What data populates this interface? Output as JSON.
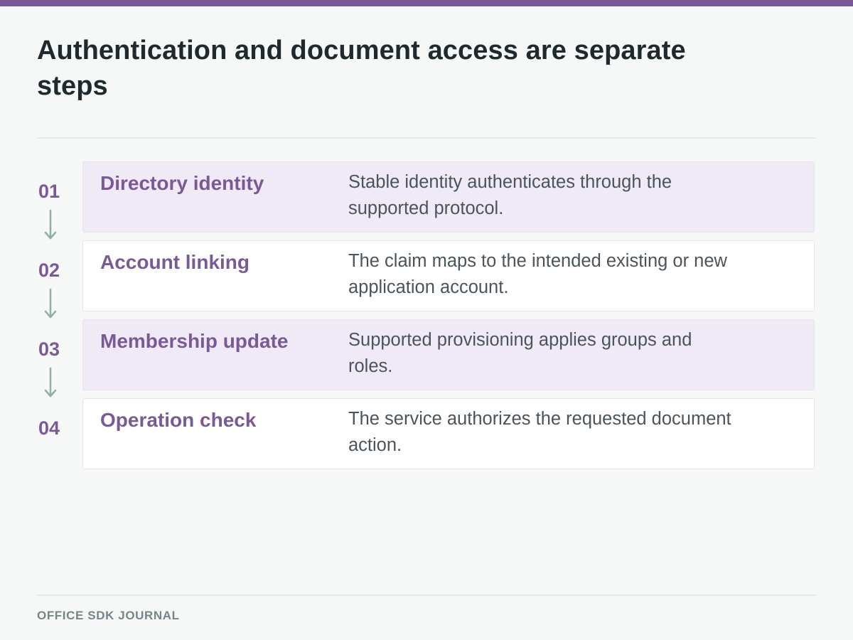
{
  "header": {
    "title": "Authentication and document access are separate steps"
  },
  "steps": [
    {
      "number": "01",
      "title": "Directory identity",
      "description": "Stable identity authenticates through the supported protocol."
    },
    {
      "number": "02",
      "title": "Account linking",
      "description": "The claim maps to the intended existing or new application account."
    },
    {
      "number": "03",
      "title": "Membership update",
      "description": "Supported provisioning applies groups and roles."
    },
    {
      "number": "04",
      "title": "Operation check",
      "description": "The service authorizes the requested document action."
    }
  ],
  "footer": {
    "brand": "OFFICE SDK JOURNAL"
  },
  "colors": {
    "accent": "#7a5a96",
    "arrow": "#8fb0a3",
    "shaded_card": "#f0e9f6",
    "background": "#f6f8f7"
  },
  "icons": {
    "connector": "arrow-down-icon"
  }
}
